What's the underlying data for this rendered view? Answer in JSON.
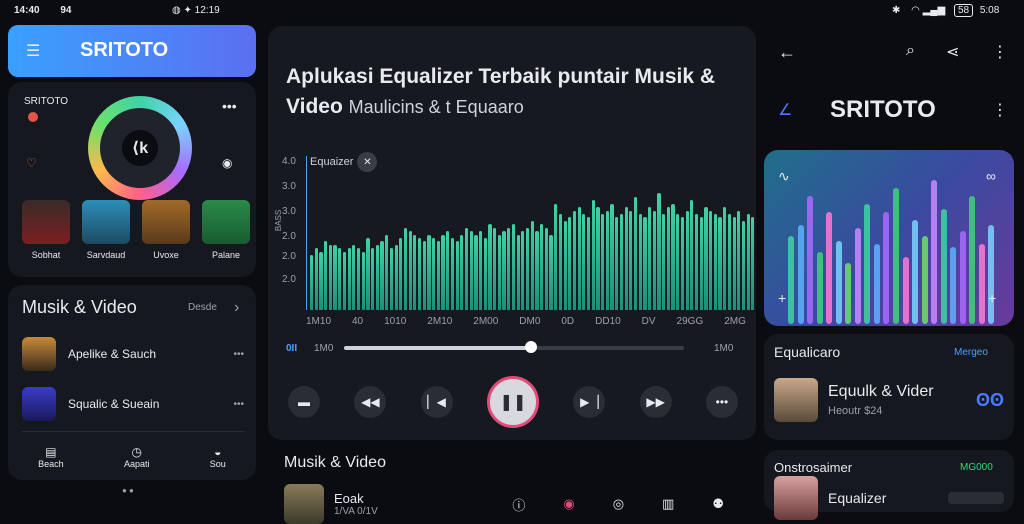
{
  "status_left": {
    "time": "14:40",
    "extra": "94",
    "right_time": "12:19"
  },
  "status_right": {
    "battery": "58",
    "time": "5:08"
  },
  "left": {
    "header_title": "SRITOTO",
    "profile_label": "SRITOTO",
    "playlist_tiles": [
      "Sobhat",
      "Sarvdaud",
      "Uvoxe",
      "Palane"
    ],
    "section_title": "Musik & Video",
    "section_action": "Desde",
    "list": [
      {
        "title": "Apelike & Sauch"
      },
      {
        "title": "Squalic & Sueain"
      }
    ],
    "bottom_nav": [
      "Beach",
      "Aapati",
      "Sou"
    ]
  },
  "center": {
    "headline_bold": "Aplukasi Equalizer Terbaik puntair Musik &",
    "headline_line2_bold": "Video",
    "headline_line2_rest": "Maulicins & t Equaaro",
    "chart_badge": "Equaizer",
    "y_axis_ticks": [
      "4.0",
      "3.0",
      "3.0",
      "2.0",
      "2.0",
      "2.0"
    ],
    "y_axis_title": "BASS",
    "x_axis_ticks": [
      "1M10",
      "40",
      "1010",
      "2M10",
      "2M00",
      "DM0",
      "0D",
      "DD10",
      "DV",
      "29GG",
      "2MG"
    ],
    "time_left_icon": "0II",
    "time_left": "1M0",
    "time_right": "1M0",
    "progress": 0.55,
    "section_title": "Musik & Video",
    "track_title": "Eoak",
    "track_sub": "1/VA 0/1V",
    "nav": [
      "",
      "",
      "",
      "",
      ""
    ]
  },
  "right": {
    "app_title": "SRITOTO",
    "card_title": "Equalicaro",
    "card_action": "Mergeo",
    "item_title": "Equulk & Vider",
    "item_sub": "Heoutr $24",
    "section2_title": "Onstrosaimer",
    "section2_action": "MG000",
    "item2_title": "Equalizer"
  },
  "chart_data": {
    "type": "bar",
    "title": "Equaizer",
    "ylabel": "BASS",
    "y_tick_labels": [
      "4.0",
      "3.0",
      "3.0",
      "2.0",
      "2.0",
      "2.0"
    ],
    "x_tick_labels": [
      "1M10",
      "40",
      "1010",
      "2M10",
      "2M00",
      "DM0",
      "0D",
      "DD10",
      "DV",
      "29GG",
      "2MG"
    ],
    "values": [
      1.6,
      1.8,
      1.7,
      2.0,
      1.9,
      1.9,
      1.8,
      1.7,
      1.8,
      1.9,
      1.8,
      1.7,
      2.1,
      1.8,
      1.9,
      2.0,
      2.2,
      1.8,
      1.9,
      2.1,
      2.4,
      2.3,
      2.2,
      2.1,
      2.0,
      2.2,
      2.1,
      2.0,
      2.2,
      2.3,
      2.1,
      2.0,
      2.2,
      2.4,
      2.3,
      2.2,
      2.3,
      2.1,
      2.5,
      2.4,
      2.2,
      2.3,
      2.4,
      2.5,
      2.2,
      2.3,
      2.4,
      2.6,
      2.3,
      2.5,
      2.4,
      2.2,
      3.1,
      2.8,
      2.6,
      2.7,
      2.9,
      3.0,
      2.8,
      2.7,
      3.2,
      3.0,
      2.8,
      2.9,
      3.1,
      2.7,
      2.8,
      3.0,
      2.9,
      3.3,
      2.8,
      2.7,
      3.0,
      2.9,
      3.4,
      2.8,
      3.0,
      3.1,
      2.8,
      2.7,
      2.9,
      3.2,
      2.8,
      2.7,
      3.0,
      2.9,
      2.8,
      2.7,
      3.0,
      2.8,
      2.7,
      2.9,
      2.6,
      2.8,
      2.7
    ],
    "ylim": [
      0,
      4.2
    ]
  }
}
